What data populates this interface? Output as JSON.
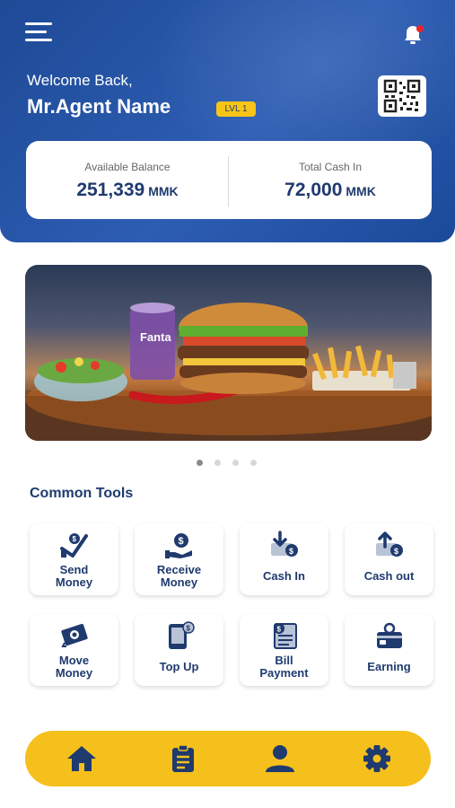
{
  "header": {
    "welcome_text": "Welcome Back,",
    "agent_name": "Mr.Agent Name",
    "level_badge": "LVL 1",
    "icons": [
      "menu-icon",
      "notification-bell-icon",
      "qr-code-icon"
    ]
  },
  "balance": {
    "available_label": "Available Balance",
    "available_value": "251,339",
    "available_unit": "MMK",
    "cash_in_label": "Total Cash In",
    "cash_in_value": "72,000",
    "cash_in_unit": "MMK"
  },
  "carousel": {
    "slide_count": 4,
    "active_index": 0,
    "banner_text": "Fanta"
  },
  "tools": {
    "title": "Common Tools",
    "items": [
      {
        "label": "Send\nMoney",
        "icon": "send-money-icon"
      },
      {
        "label": "Receive\nMoney",
        "icon": "receive-money-icon"
      },
      {
        "label": "Cash In",
        "icon": "cash-in-icon"
      },
      {
        "label": "Cash out",
        "icon": "cash-out-icon"
      },
      {
        "label": "Move\nMoney",
        "icon": "move-money-icon"
      },
      {
        "label": "Top Up",
        "icon": "top-up-icon"
      },
      {
        "label": "Bill\nPayment",
        "icon": "bill-payment-icon"
      },
      {
        "label": "Earning",
        "icon": "earning-icon"
      }
    ]
  },
  "bottom_nav": {
    "items": [
      "home-icon",
      "clipboard-icon",
      "profile-icon",
      "settings-icon"
    ],
    "active": "home-icon"
  },
  "colors": {
    "primary_blue": "#1e4a96",
    "navy_text": "#1f3a6e",
    "accent_yellow": "#f5c01c",
    "notification_red": "#e8242b"
  }
}
